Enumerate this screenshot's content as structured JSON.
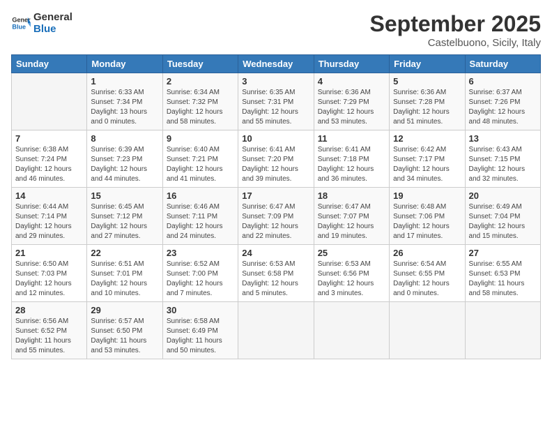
{
  "header": {
    "logo_line1": "General",
    "logo_line2": "Blue",
    "month": "September 2025",
    "location": "Castelbuono, Sicily, Italy"
  },
  "days_of_week": [
    "Sunday",
    "Monday",
    "Tuesday",
    "Wednesday",
    "Thursday",
    "Friday",
    "Saturday"
  ],
  "weeks": [
    [
      {
        "num": "",
        "info": ""
      },
      {
        "num": "1",
        "info": "Sunrise: 6:33 AM\nSunset: 7:34 PM\nDaylight: 13 hours\nand 0 minutes."
      },
      {
        "num": "2",
        "info": "Sunrise: 6:34 AM\nSunset: 7:32 PM\nDaylight: 12 hours\nand 58 minutes."
      },
      {
        "num": "3",
        "info": "Sunrise: 6:35 AM\nSunset: 7:31 PM\nDaylight: 12 hours\nand 55 minutes."
      },
      {
        "num": "4",
        "info": "Sunrise: 6:36 AM\nSunset: 7:29 PM\nDaylight: 12 hours\nand 53 minutes."
      },
      {
        "num": "5",
        "info": "Sunrise: 6:36 AM\nSunset: 7:28 PM\nDaylight: 12 hours\nand 51 minutes."
      },
      {
        "num": "6",
        "info": "Sunrise: 6:37 AM\nSunset: 7:26 PM\nDaylight: 12 hours\nand 48 minutes."
      }
    ],
    [
      {
        "num": "7",
        "info": "Sunrise: 6:38 AM\nSunset: 7:24 PM\nDaylight: 12 hours\nand 46 minutes."
      },
      {
        "num": "8",
        "info": "Sunrise: 6:39 AM\nSunset: 7:23 PM\nDaylight: 12 hours\nand 44 minutes."
      },
      {
        "num": "9",
        "info": "Sunrise: 6:40 AM\nSunset: 7:21 PM\nDaylight: 12 hours\nand 41 minutes."
      },
      {
        "num": "10",
        "info": "Sunrise: 6:41 AM\nSunset: 7:20 PM\nDaylight: 12 hours\nand 39 minutes."
      },
      {
        "num": "11",
        "info": "Sunrise: 6:41 AM\nSunset: 7:18 PM\nDaylight: 12 hours\nand 36 minutes."
      },
      {
        "num": "12",
        "info": "Sunrise: 6:42 AM\nSunset: 7:17 PM\nDaylight: 12 hours\nand 34 minutes."
      },
      {
        "num": "13",
        "info": "Sunrise: 6:43 AM\nSunset: 7:15 PM\nDaylight: 12 hours\nand 32 minutes."
      }
    ],
    [
      {
        "num": "14",
        "info": "Sunrise: 6:44 AM\nSunset: 7:14 PM\nDaylight: 12 hours\nand 29 minutes."
      },
      {
        "num": "15",
        "info": "Sunrise: 6:45 AM\nSunset: 7:12 PM\nDaylight: 12 hours\nand 27 minutes."
      },
      {
        "num": "16",
        "info": "Sunrise: 6:46 AM\nSunset: 7:11 PM\nDaylight: 12 hours\nand 24 minutes."
      },
      {
        "num": "17",
        "info": "Sunrise: 6:47 AM\nSunset: 7:09 PM\nDaylight: 12 hours\nand 22 minutes."
      },
      {
        "num": "18",
        "info": "Sunrise: 6:47 AM\nSunset: 7:07 PM\nDaylight: 12 hours\nand 19 minutes."
      },
      {
        "num": "19",
        "info": "Sunrise: 6:48 AM\nSunset: 7:06 PM\nDaylight: 12 hours\nand 17 minutes."
      },
      {
        "num": "20",
        "info": "Sunrise: 6:49 AM\nSunset: 7:04 PM\nDaylight: 12 hours\nand 15 minutes."
      }
    ],
    [
      {
        "num": "21",
        "info": "Sunrise: 6:50 AM\nSunset: 7:03 PM\nDaylight: 12 hours\nand 12 minutes."
      },
      {
        "num": "22",
        "info": "Sunrise: 6:51 AM\nSunset: 7:01 PM\nDaylight: 12 hours\nand 10 minutes."
      },
      {
        "num": "23",
        "info": "Sunrise: 6:52 AM\nSunset: 7:00 PM\nDaylight: 12 hours\nand 7 minutes."
      },
      {
        "num": "24",
        "info": "Sunrise: 6:53 AM\nSunset: 6:58 PM\nDaylight: 12 hours\nand 5 minutes."
      },
      {
        "num": "25",
        "info": "Sunrise: 6:53 AM\nSunset: 6:56 PM\nDaylight: 12 hours\nand 3 minutes."
      },
      {
        "num": "26",
        "info": "Sunrise: 6:54 AM\nSunset: 6:55 PM\nDaylight: 12 hours\nand 0 minutes."
      },
      {
        "num": "27",
        "info": "Sunrise: 6:55 AM\nSunset: 6:53 PM\nDaylight: 11 hours\nand 58 minutes."
      }
    ],
    [
      {
        "num": "28",
        "info": "Sunrise: 6:56 AM\nSunset: 6:52 PM\nDaylight: 11 hours\nand 55 minutes."
      },
      {
        "num": "29",
        "info": "Sunrise: 6:57 AM\nSunset: 6:50 PM\nDaylight: 11 hours\nand 53 minutes."
      },
      {
        "num": "30",
        "info": "Sunrise: 6:58 AM\nSunset: 6:49 PM\nDaylight: 11 hours\nand 50 minutes."
      },
      {
        "num": "",
        "info": ""
      },
      {
        "num": "",
        "info": ""
      },
      {
        "num": "",
        "info": ""
      },
      {
        "num": "",
        "info": ""
      }
    ]
  ]
}
